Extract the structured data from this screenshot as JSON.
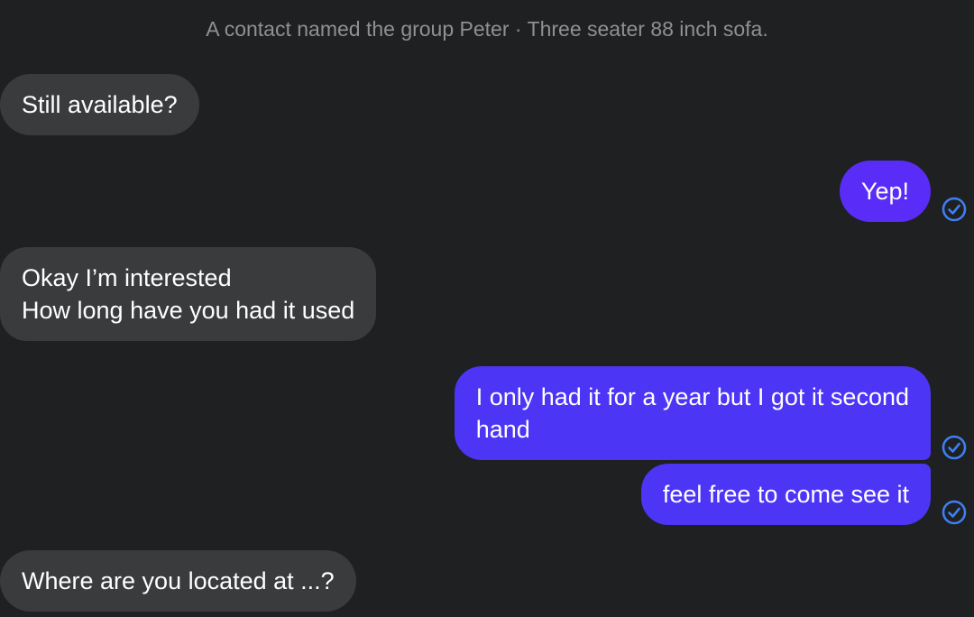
{
  "system_notice": "A contact named the group Peter · Three seater 88 inch sofa.",
  "messages": [
    {
      "direction": "incoming",
      "text": "Still available?"
    },
    {
      "direction": "outgoing",
      "text": "Yep!",
      "status": "sent-check-icon"
    },
    {
      "direction": "incoming",
      "text": "Okay I’m interested\nHow long have you had it used"
    },
    {
      "direction": "outgoing",
      "text": "I only had it for a year but I got it second\nhand",
      "status": "sent-check-icon"
    },
    {
      "direction": "outgoing",
      "text": "feel free to come see it",
      "status": "sent-check-icon"
    },
    {
      "direction": "incoming",
      "text": "Where are you located at ...?"
    }
  ],
  "colors": {
    "background": "#1f2022",
    "incoming_bubble": "#3a3b3d",
    "outgoing_bubble": "#4c35f5",
    "status_icon": "#3d7ff2",
    "system_text": "#8f9093"
  }
}
